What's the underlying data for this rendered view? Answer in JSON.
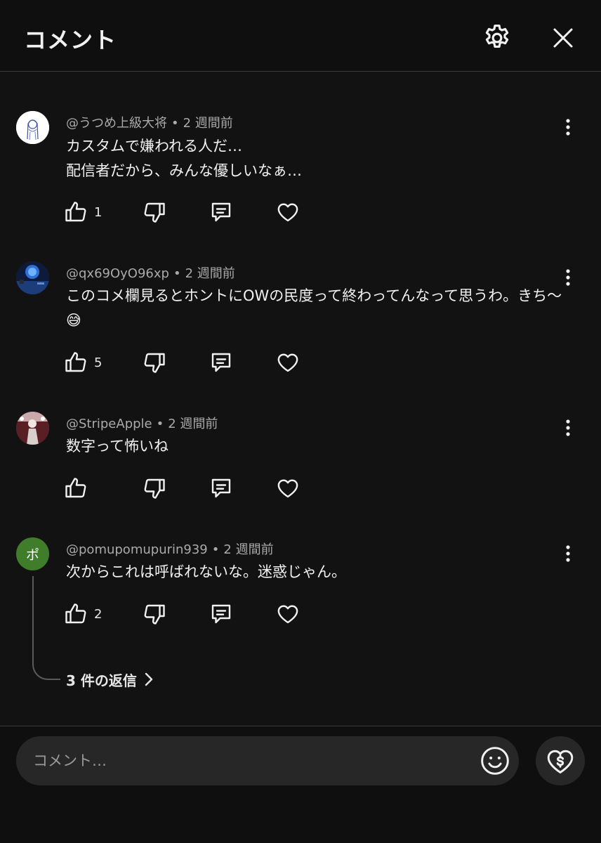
{
  "header": {
    "title": "コメント",
    "settings_icon": "gear-icon",
    "close_icon": "close-icon"
  },
  "comments": [
    {
      "handle": "@うつめ上級大将",
      "age": "2 週間前",
      "lines": [
        "カスタムで嫌われる人だ…",
        "配信者だから、みんな優しいなぁ…"
      ],
      "likes": "1",
      "avatar": {
        "type": "image",
        "bg": "#ffffff"
      }
    },
    {
      "handle": "@qx69OyO96xp",
      "age": "2 週間前",
      "lines": [
        "このコメ欄見るとホントにOWの民度って終わってんなって思うわ。きち～😅"
      ],
      "likes": "5",
      "avatar": {
        "type": "image",
        "bg": "#1b3a66"
      }
    },
    {
      "handle": "@StripeApple",
      "age": "2 週間前",
      "lines": [
        "数字って怖いね"
      ],
      "likes": "",
      "avatar": {
        "type": "image",
        "bg": "#7a2a2a"
      }
    },
    {
      "handle": "@pomupomupurin939",
      "age": "2 週間前",
      "lines": [
        "次からこれは呼ばれないな。迷惑じゃん。"
      ],
      "likes": "2",
      "avatar": {
        "type": "initial",
        "initial": "ポ",
        "bg": "#3f7d2a"
      }
    }
  ],
  "replies": {
    "label": "3 件の返信"
  },
  "composer": {
    "placeholder": "コメント…",
    "emoji_icon": "smile-emoji-icon",
    "super_thanks_icon": "heart-dollar-icon"
  },
  "colors": {
    "background": "#121212",
    "text": "#f1f1f1",
    "secondary_text": "#aaaaaa",
    "input_bg": "#272727"
  }
}
